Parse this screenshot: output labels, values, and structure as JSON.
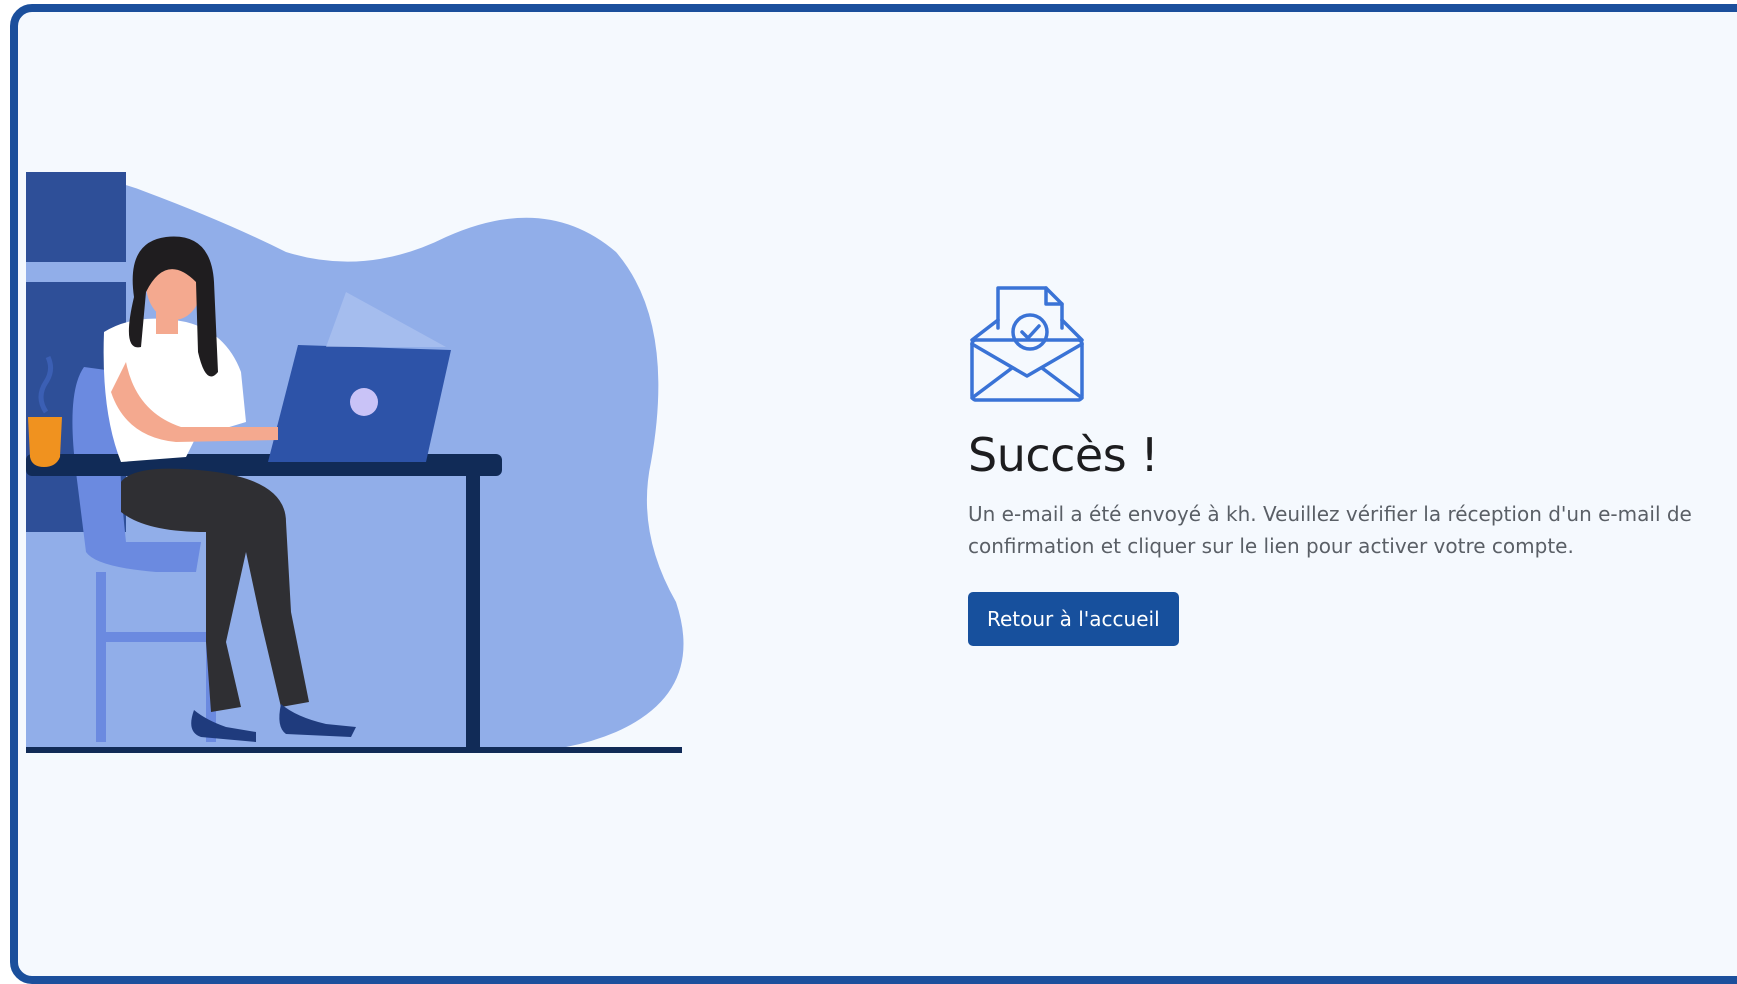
{
  "success": {
    "title": "Succès !",
    "message": "Un e-mail a été envoyé à kh. Veuillez vérifier la réception d'un e-mail de confirmation et cliquer sur le lien pour activer votre compte.",
    "button_label": "Retour à l'accueil",
    "icon": "mail-check-icon"
  },
  "colors": {
    "frame_border": "#1b4f9c",
    "background": "#f5f9fe",
    "button": "#17509d",
    "icon_stroke": "#3a73d6",
    "blob": "#91aee9"
  }
}
